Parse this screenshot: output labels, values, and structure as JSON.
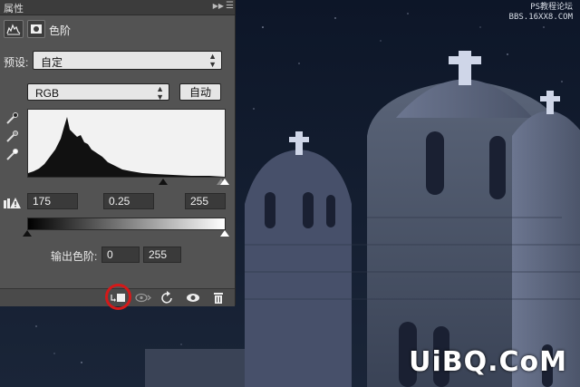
{
  "panel": {
    "title": "属性",
    "adjustment_name": "色阶",
    "preset_label": "预设:",
    "preset_value": "自定",
    "channel_value": "RGB",
    "auto_label": "自动",
    "input_black": "175",
    "input_gamma": "0.25",
    "input_white": "255",
    "output_label": "输出色阶:",
    "output_black": "0",
    "output_white": "255",
    "icons": [
      "levels-icon",
      "mask-icon",
      "black-eyedropper-icon",
      "gray-eyedropper-icon",
      "white-eyedropper-icon",
      "clipping-warning-icon",
      "clip-to-layer-icon",
      "view-previous-icon",
      "reset-icon",
      "visibility-eye-icon",
      "trash-icon"
    ],
    "highlight_color": "#d41919"
  },
  "watermark": {
    "top_line1": "PS教程论坛",
    "top_line2": "BBS.16XX8.COM",
    "bottom": "UiBQ.CoM"
  }
}
